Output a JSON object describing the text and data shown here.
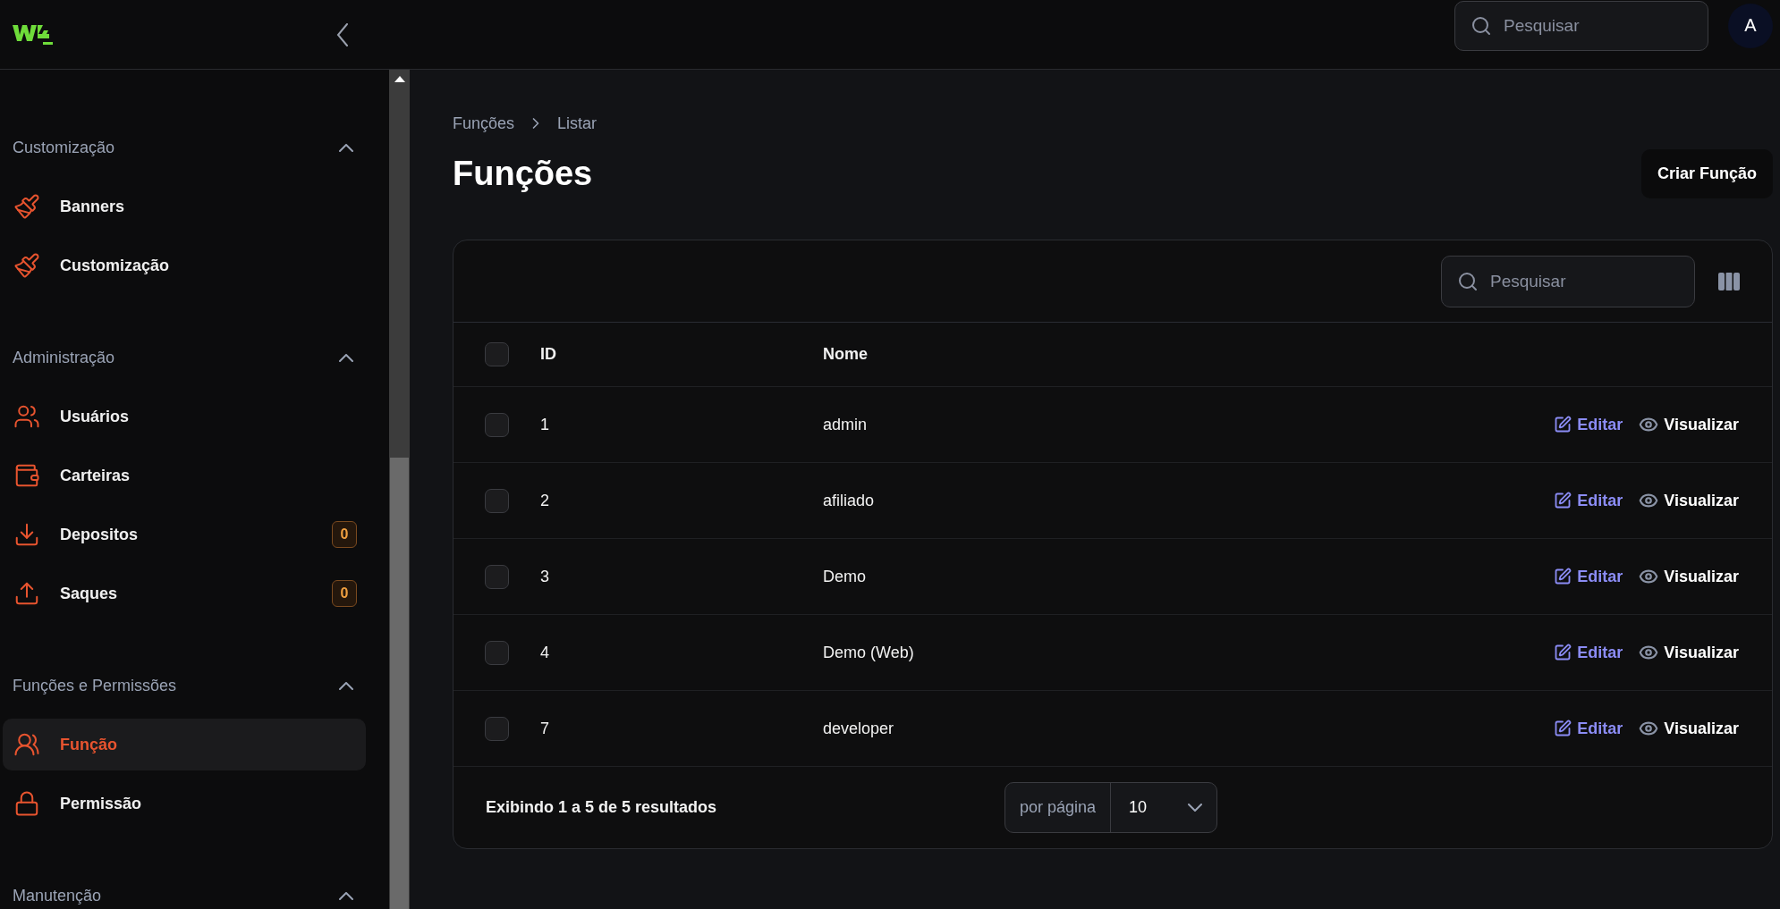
{
  "header": {
    "search_placeholder": "Pesquisar",
    "avatar": "A"
  },
  "sidebar": {
    "sections": [
      {
        "title": "Customização",
        "expanded": true,
        "items": [
          {
            "label": "Banners",
            "selected": false
          },
          {
            "label": "Customização",
            "selected": false
          }
        ]
      },
      {
        "title": "Administração",
        "expanded": true,
        "items": [
          {
            "label": "Usuários",
            "selected": false
          },
          {
            "label": "Carteiras",
            "selected": false
          },
          {
            "label": "Depositos",
            "selected": false,
            "badge": "0"
          },
          {
            "label": "Saques",
            "selected": false,
            "badge": "0"
          }
        ]
      },
      {
        "title": "Funções e Permissões",
        "expanded": true,
        "items": [
          {
            "label": "Função",
            "selected": true
          },
          {
            "label": "Permissão",
            "selected": false
          }
        ]
      },
      {
        "title": "Manutenção",
        "expanded": true
      }
    ]
  },
  "breadcrumbs": [
    "Funções",
    "Listar"
  ],
  "title": "Funções",
  "create_button": "Criar Função",
  "table": {
    "search_placeholder": "Pesquisar",
    "all_checked": false,
    "columns": [
      "ID",
      "Nome"
    ],
    "rows": [
      {
        "id": "1",
        "name": "admin",
        "checked": false,
        "actions": [
          "Editar",
          "Visualizar"
        ]
      },
      {
        "id": "2",
        "name": "afiliado",
        "checked": false,
        "actions": [
          "Editar",
          "Visualizar"
        ]
      },
      {
        "id": "3",
        "name": "Demo",
        "checked": false,
        "actions": [
          "Editar",
          "Visualizar"
        ]
      },
      {
        "id": "4",
        "name": "Demo (Web)",
        "checked": false,
        "actions": [
          "Editar",
          "Visualizar"
        ]
      },
      {
        "id": "7",
        "name": "developer",
        "checked": false,
        "actions": [
          "Editar",
          "Visualizar"
        ]
      }
    ],
    "footer": {
      "summary": "Exibindo 1 a 5 de 5 resultados",
      "per_page_label": "por página",
      "per_page": "10"
    }
  }
}
